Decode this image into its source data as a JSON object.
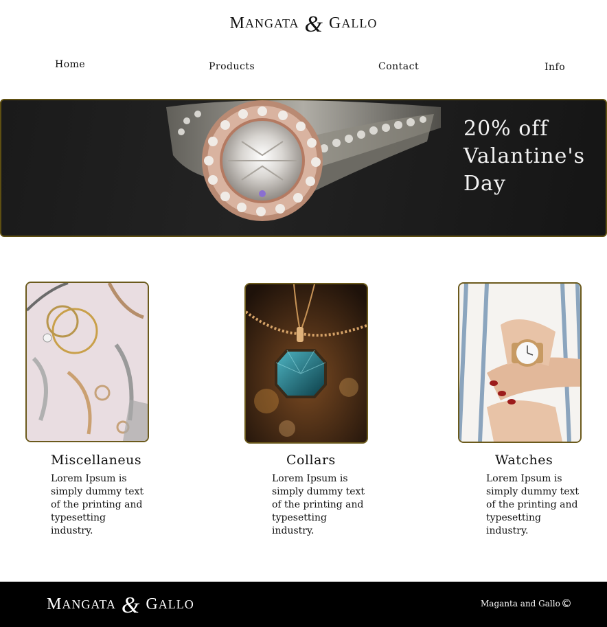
{
  "brand": {
    "logo_part1_big": "M",
    "logo_part1_small": "ANGATA",
    "logo_amp": "&",
    "logo_part2_big": "G",
    "logo_part2_small": "ALLO"
  },
  "nav": {
    "home": "Home",
    "products": "Products",
    "contact": "Contact",
    "info": "Info"
  },
  "hero": {
    "line1": "20% off",
    "line2": "Valantine's",
    "line3": "Day"
  },
  "categories": [
    {
      "title": "Miscellaneus",
      "text": "Lorem Ipsum is simply dummy text of the printing and typesetting industry."
    },
    {
      "title": "Collars",
      "text": "Lorem Ipsum is simply dummy text of the printing and typesetting industry."
    },
    {
      "title": "Watches",
      "text": "Lorem Ipsum is simply dummy text of the printing and typesetting industry."
    }
  ],
  "footer": {
    "copyright_text": "Maganta and Gallo",
    "copyright_symbol": "©"
  },
  "colors": {
    "card_border": "#6b5a1c",
    "footer_bg": "#000000"
  }
}
